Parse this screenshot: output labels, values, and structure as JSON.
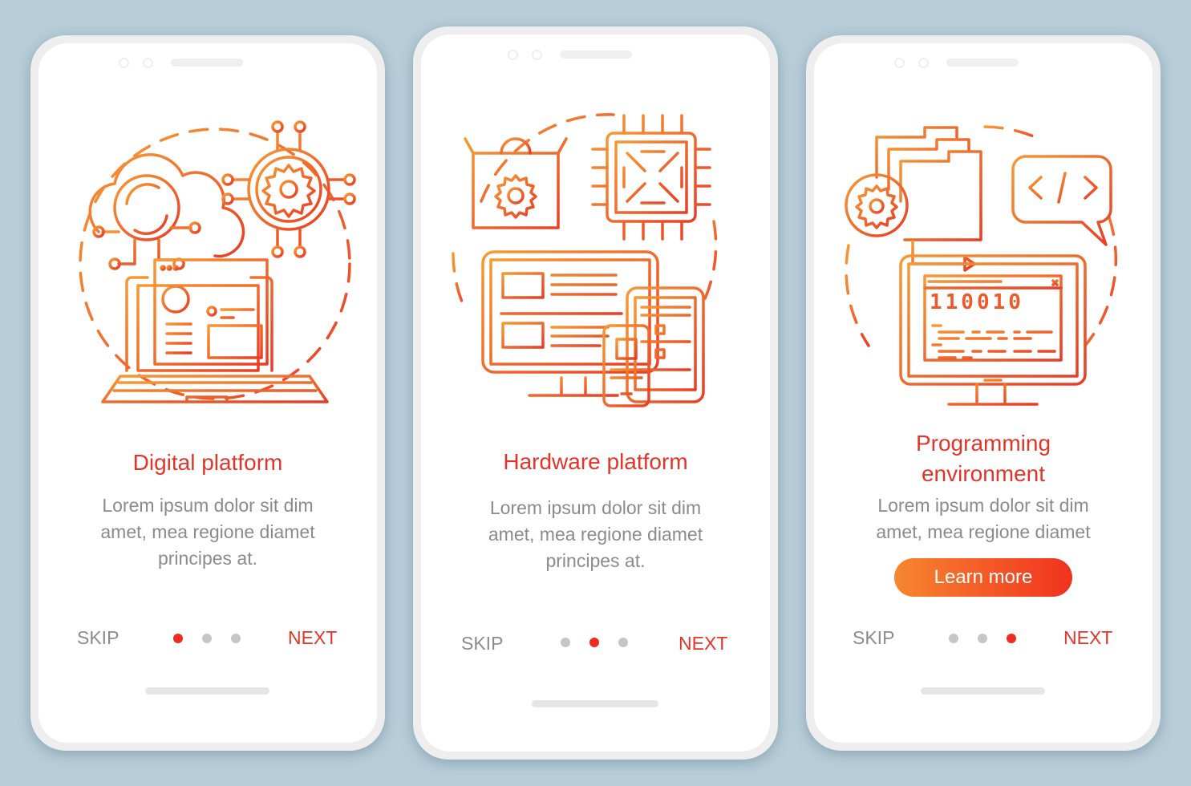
{
  "colors": {
    "background": "#b7cdd9",
    "accent_red": "#e2352a",
    "accent_orange": "#f7862e",
    "body_gray": "#8b8b8b",
    "dot_inactive": "#c6c6c6",
    "dot_active": "#ee2c22"
  },
  "screens": [
    {
      "illustration": "cloud-gear-laptop-icon",
      "title": "Digital platform",
      "body": [
        "Lorem ipsum dolor sit dim",
        "amet, mea regione diamet",
        "principes at."
      ],
      "skip_label": "SKIP",
      "next_label": "NEXT",
      "page_indicator": {
        "current": 1,
        "total": 3
      }
    },
    {
      "illustration": "box-chip-devices-icon",
      "title": "Hardware platform",
      "body": [
        "Lorem ipsum dolor sit dim",
        "amet, mea regione diamet",
        "principes at."
      ],
      "skip_label": "SKIP",
      "next_label": "NEXT",
      "page_indicator": {
        "current": 2,
        "total": 3
      }
    },
    {
      "illustration": "folders-code-monitor-icon",
      "title_lines": [
        "Programming",
        "environment"
      ],
      "body": [
        "Lorem ipsum dolor sit dim",
        "amet, mea regione diamet"
      ],
      "cta_label": "Learn more",
      "skip_label": "SKIP",
      "next_label": "NEXT",
      "page_indicator": {
        "current": 3,
        "total": 3
      },
      "monitor_code": "110010"
    }
  ]
}
